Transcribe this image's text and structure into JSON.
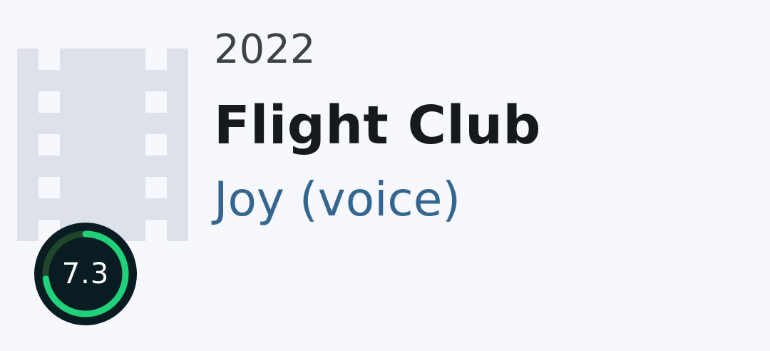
{
  "movie": {
    "year": "2022",
    "title": "Flight Club",
    "role": "Joy (voice)",
    "rating": "7.3",
    "rating_fraction": 0.73,
    "poster_icon": "film-strip-icon"
  },
  "colors": {
    "background": "#f6f8fd",
    "poster_placeholder": "#dde2ea",
    "rating_ring": "#21d07a",
    "rating_track": "#204529",
    "rating_bg": "#081c22",
    "role_link": "#356690"
  }
}
